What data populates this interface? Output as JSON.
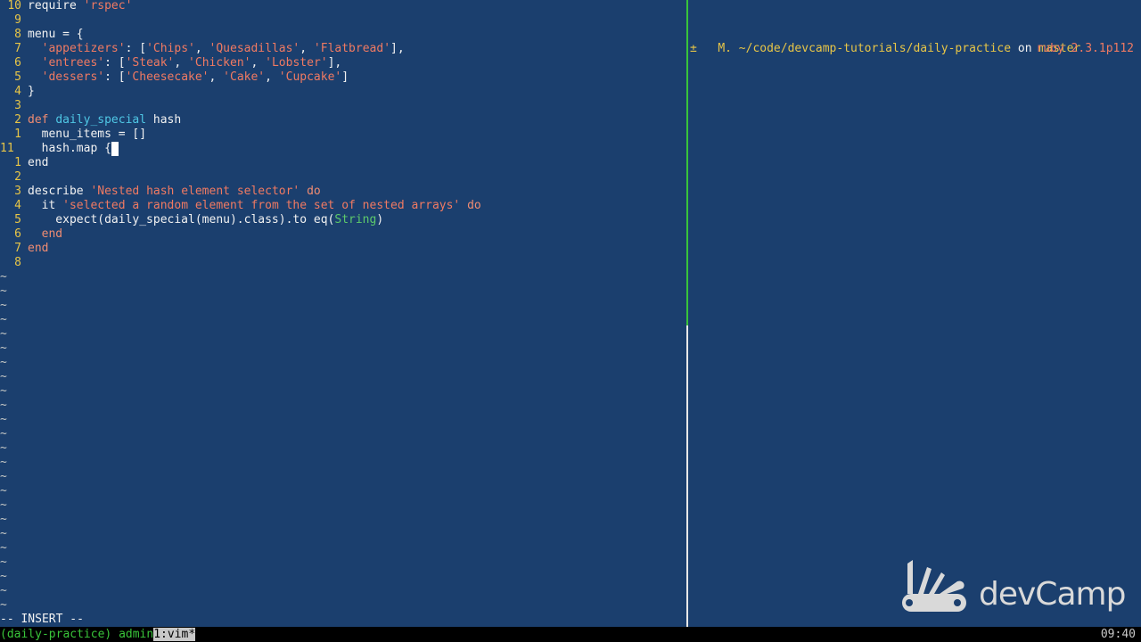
{
  "editor": {
    "lines": [
      {
        "num": "10",
        "html": "require <span class=\"str\">'rspec'</span>"
      },
      {
        "num": "9",
        "html": ""
      },
      {
        "num": "8",
        "html": "menu = {"
      },
      {
        "num": "7",
        "html": "  <span class=\"str\">'appetizers'</span>: [<span class=\"str\">'Chips'</span>, <span class=\"str\">'Quesadillas'</span>, <span class=\"str\">'Flatbread'</span>],"
      },
      {
        "num": "6",
        "html": "  <span class=\"str\">'entrees'</span>: [<span class=\"str\">'Steak'</span>, <span class=\"str\">'Chicken'</span>, <span class=\"str\">'Lobster'</span>],"
      },
      {
        "num": "5",
        "html": "  <span class=\"str\">'dessers'</span>: [<span class=\"str\">'Cheesecake'</span>, <span class=\"str\">'Cake'</span>, <span class=\"str\">'Cupcake'</span>]"
      },
      {
        "num": "4",
        "html": "}"
      },
      {
        "num": "3",
        "html": ""
      },
      {
        "num": "2",
        "html": "<span class=\"kw\">def</span> <span class=\"fn\">daily_special</span> hash"
      },
      {
        "num": "1",
        "html": "  menu_items = []"
      },
      {
        "num": "11",
        "html": "  hash.map {<span class=\"cursor\">&nbsp;</span>",
        "current": true
      },
      {
        "num": "1",
        "html": "end"
      },
      {
        "num": "2",
        "html": ""
      },
      {
        "num": "3",
        "html": "describe <span class=\"str\">'Nested hash element selector'</span> <span class=\"kw\">do</span>"
      },
      {
        "num": "4",
        "html": "  it <span class=\"str\">'selected a random element from the set of nested arrays'</span> <span class=\"kw\">do</span>"
      },
      {
        "num": "5",
        "html": "    expect(daily_special(menu).class).to eq(<span class=\"const\">String</span>)"
      },
      {
        "num": "6",
        "html": "  <span class=\"kw\">end</span>"
      },
      {
        "num": "7",
        "html": "<span class=\"kw\">end</span>"
      },
      {
        "num": "8",
        "html": ""
      }
    ],
    "tilde_count": 24,
    "tilde": "~",
    "mode": "-- INSERT --"
  },
  "terminal": {
    "modified": "M.",
    "path": "~/code/devcamp-tutorials/daily-practice",
    "on": "on",
    "branch": "master",
    "prompt_symbol": "±",
    "ruby_version": "ruby 2.3.1p112"
  },
  "tmux": {
    "session": "(daily-practice)",
    "user": "admin",
    "window": "1:vim*",
    "time": "09:40"
  },
  "logo": {
    "text": "devCamp",
    "icon": "devcamp-knife-icon"
  },
  "colors": {
    "background": "#1b3f6e",
    "line_number": "#e7c547",
    "string": "#f07a62",
    "keyword": "#f08c72",
    "function": "#4fc7e5",
    "constant": "#5dc96b",
    "tmux_green": "#39c43a"
  }
}
